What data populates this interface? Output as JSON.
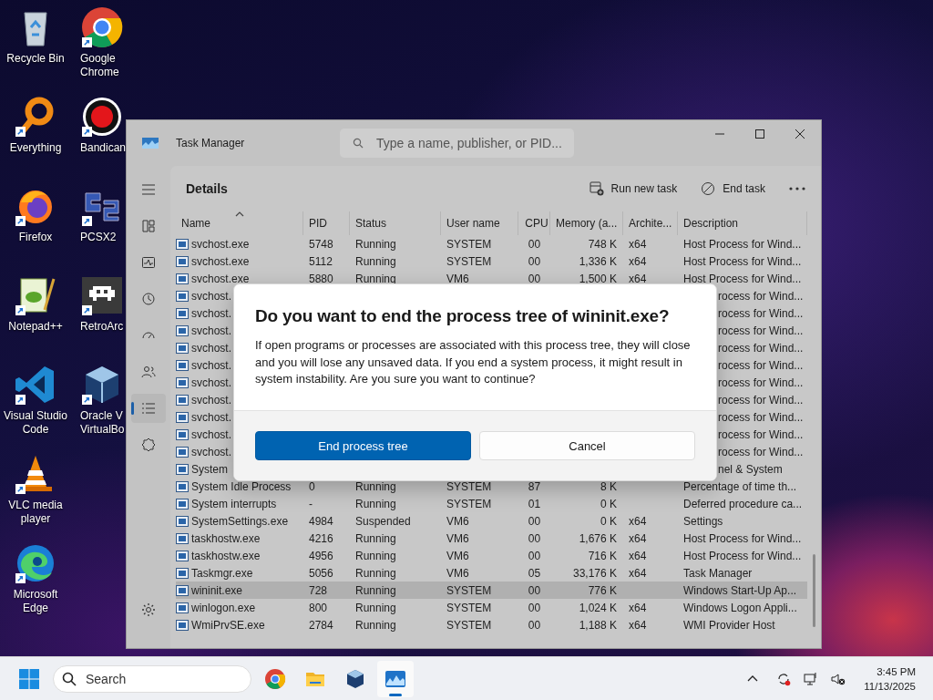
{
  "desktop_icons": [
    {
      "label": "Recycle Bin",
      "shortcut": false
    },
    {
      "label": "Everything",
      "shortcut": true
    },
    {
      "label": "Firefox",
      "shortcut": true
    },
    {
      "label": "Notepad++",
      "shortcut": true
    },
    {
      "label": "Visual Studio Code",
      "shortcut": true
    },
    {
      "label": "VLC media player",
      "shortcut": true
    },
    {
      "label": "Microsoft Edge",
      "shortcut": true
    },
    {
      "label": "Google Chrome",
      "shortcut": true
    },
    {
      "label": "Bandican",
      "shortcut": true
    },
    {
      "label": "PCSX2",
      "shortcut": true
    },
    {
      "label": "RetroArc",
      "shortcut": true
    },
    {
      "label": "Oracle V VirtualBo",
      "shortcut": true
    }
  ],
  "window": {
    "title": "Task Manager",
    "search": {
      "placeholder": "Type a name, publisher, or PID..."
    }
  },
  "nav_items": [
    {
      "selected": false
    },
    {
      "selected": false
    },
    {
      "selected": false
    },
    {
      "selected": false
    },
    {
      "selected": false
    },
    {
      "selected": true
    },
    {
      "selected": false
    }
  ],
  "page": {
    "title": "Details",
    "actions": [
      "Run new task",
      "End task"
    ]
  },
  "table": {
    "columns": [
      {
        "label": "Name",
        "sorted": true
      },
      {
        "label": "PID",
        "sorted": false
      },
      {
        "label": "Status",
        "sorted": false
      },
      {
        "label": "User name",
        "sorted": false
      },
      {
        "label": "CPU",
        "sorted": false
      },
      {
        "label": "Memory (a...",
        "sorted": false
      },
      {
        "label": "Archite...",
        "sorted": false
      },
      {
        "label": "Description",
        "sorted": false
      }
    ],
    "rows": [
      {
        "kind": "full",
        "name": "svchost.exe",
        "pid": "5748",
        "status": "Running",
        "user": "SYSTEM",
        "cpu": "00",
        "memory": "748 K",
        "arch": "x64",
        "description": "Host Process for Wind...",
        "selected": false
      },
      {
        "kind": "full",
        "name": "svchost.exe",
        "pid": "5112",
        "status": "Running",
        "user": "SYSTEM",
        "cpu": "00",
        "memory": "1,336 K",
        "arch": "x64",
        "description": "Host Process for Wind...",
        "selected": false
      },
      {
        "kind": "full",
        "name": "svchost.exe",
        "pid": "5880",
        "status": "Running",
        "user": "VM6",
        "cpu": "00",
        "memory": "1,500 K",
        "arch": "x64",
        "description": "Host Process for Wind...",
        "selected": false
      },
      {
        "kind": "covered",
        "name": "svchost.",
        "description": "rocess for Wind...",
        "selected": false
      },
      {
        "kind": "covered",
        "name": "svchost.",
        "description": "rocess for Wind...",
        "selected": false
      },
      {
        "kind": "covered",
        "name": "svchost.",
        "description": "rocess for Wind...",
        "selected": false
      },
      {
        "kind": "covered",
        "name": "svchost.",
        "description": "rocess for Wind...",
        "selected": false
      },
      {
        "kind": "covered",
        "name": "svchost.",
        "description": "rocess for Wind...",
        "selected": false
      },
      {
        "kind": "covered",
        "name": "svchost.",
        "description": "rocess for Wind...",
        "selected": false
      },
      {
        "kind": "covered",
        "name": "svchost.",
        "description": "rocess for Wind...",
        "selected": false
      },
      {
        "kind": "covered",
        "name": "svchost.",
        "description": "rocess for Wind...",
        "selected": false
      },
      {
        "kind": "covered",
        "name": "svchost.",
        "description": "rocess for Wind...",
        "selected": false
      },
      {
        "kind": "covered",
        "name": "svchost.",
        "description": "rocess for Wind...",
        "selected": false
      },
      {
        "kind": "covered",
        "name": "System",
        "description": "nel & System",
        "selected": false
      },
      {
        "kind": "full",
        "name": "System Idle Process",
        "pid": "0",
        "status": "Running",
        "user": "SYSTEM",
        "cpu": "87",
        "memory": "8 K",
        "description": "Percentage of time th...",
        "selected": false
      },
      {
        "kind": "full",
        "name": "System interrupts",
        "pid": "-",
        "status": "Running",
        "user": "SYSTEM",
        "cpu": "01",
        "memory": "0 K",
        "description": "Deferred procedure ca...",
        "selected": false
      },
      {
        "kind": "full",
        "name": "SystemSettings.exe",
        "pid": "4984",
        "status": "Suspended",
        "user": "VM6",
        "cpu": "00",
        "memory": "0 K",
        "arch": "x64",
        "description": "Settings",
        "selected": false
      },
      {
        "kind": "full",
        "name": "taskhostw.exe",
        "pid": "4216",
        "status": "Running",
        "user": "VM6",
        "cpu": "00",
        "memory": "1,676 K",
        "arch": "x64",
        "description": "Host Process for Wind...",
        "selected": false
      },
      {
        "kind": "full",
        "name": "taskhostw.exe",
        "pid": "4956",
        "status": "Running",
        "user": "VM6",
        "cpu": "00",
        "memory": "716 K",
        "arch": "x64",
        "description": "Host Process for Wind...",
        "selected": false
      },
      {
        "kind": "full",
        "name": "Taskmgr.exe",
        "pid": "5056",
        "status": "Running",
        "user": "VM6",
        "cpu": "05",
        "memory": "33,176 K",
        "arch": "x64",
        "description": "Task Manager",
        "selected": false
      },
      {
        "kind": "full",
        "name": "wininit.exe",
        "pid": "728",
        "status": "Running",
        "user": "SYSTEM",
        "cpu": "00",
        "memory": "776 K",
        "description": "Windows Start-Up Ap...",
        "selected": true
      },
      {
        "kind": "full",
        "name": "winlogon.exe",
        "pid": "800",
        "status": "Running",
        "user": "SYSTEM",
        "cpu": "00",
        "memory": "1,024 K",
        "arch": "x64",
        "description": "Windows Logon Appli...",
        "selected": false
      },
      {
        "kind": "full",
        "name": "WmiPrvSE.exe",
        "pid": "2784",
        "status": "Running",
        "user": "SYSTEM",
        "cpu": "00",
        "memory": "1,188 K",
        "arch": "x64",
        "description": "WMI Provider Host",
        "selected": false
      }
    ]
  },
  "dialog": {
    "title": "Do you want to end the process tree of wininit.exe?",
    "message": "If open programs or processes are associated with this process tree, they will close and you will lose any unsaved data. If you end a system process, it might result in system instability. Are you sure you want to continue?",
    "buttons": [
      {
        "label": "End process tree",
        "kind": "primary"
      },
      {
        "label": "Cancel",
        "kind": "secondary"
      }
    ]
  },
  "taskbar": {
    "search_placeholder": "Search",
    "apps": [
      {
        "active": false
      },
      {
        "active": false
      },
      {
        "active": false
      },
      {
        "active": true
      }
    ],
    "time": "3:45 PM",
    "date": "11/13/2025"
  }
}
